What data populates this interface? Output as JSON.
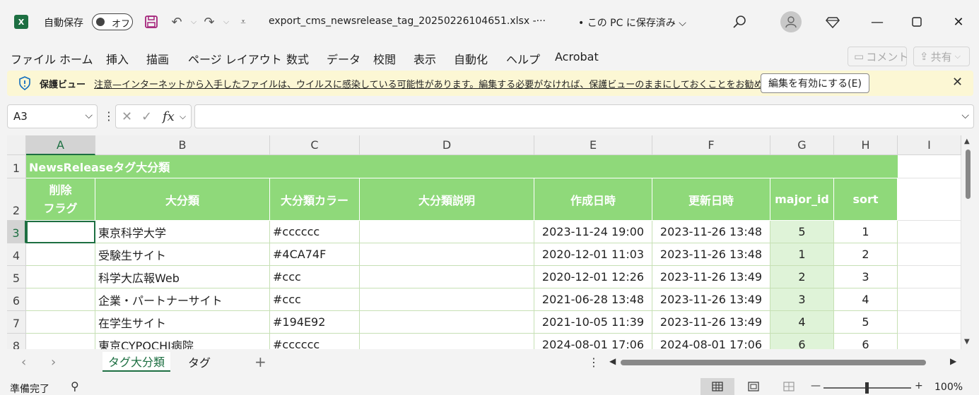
{
  "titlebar": {
    "app_logo": "X",
    "autosave_label": "自動保存",
    "autosave_state": "オフ",
    "filename": "export_cms_newsrelease_tag_20250226104651.xlsx  -···",
    "save_state": "• この PC に保存済み ⌵",
    "icons": [
      "save-icon",
      "undo-icon",
      "redo-icon",
      "customize-icon",
      "search-icon",
      "avatar",
      "diamond-icon",
      "minimize-icon",
      "maximize-icon",
      "close-icon"
    ]
  },
  "menu": {
    "items": [
      "ファイル",
      "ホーム",
      "挿入",
      "描画",
      "ページ レイアウト",
      "数式",
      "データ",
      "校閲",
      "表示",
      "自動化",
      "ヘルプ",
      "Acrobat"
    ],
    "comment_label": "コメント",
    "share_label": "共有"
  },
  "protected_view": {
    "title": "保護ビュー",
    "message": "注意—インターネットから入手したファイルは、ウイルスに感染している可能性があります。編集する必要がなければ、保護ビューのままにしておくことをお勧めします。",
    "enable_button": "編集を有効にする(E)"
  },
  "formula_bar": {
    "name_box": "A3",
    "fx_label": "fx",
    "formula": ""
  },
  "grid": {
    "columns": [
      "A",
      "B",
      "C",
      "D",
      "E",
      "F",
      "G",
      "H",
      "I"
    ],
    "rows": [
      "1",
      "2",
      "3",
      "4",
      "5",
      "6",
      "7",
      "8"
    ],
    "sheet_title": "NewsReleaseタグ大分類",
    "header_a_line1": "削除",
    "header_a_line2": "フラグ",
    "headers": [
      "大分類",
      "大分類カラー",
      "大分類説明",
      "作成日時",
      "更新日時",
      "major_id",
      "sort"
    ],
    "data": [
      {
        "del": "",
        "name": "東京科学大学",
        "color": "#cccccc",
        "desc": "",
        "created": "2023-11-24 19:00",
        "updated": "2023-11-26 13:48",
        "major_id": "5",
        "sort": "1"
      },
      {
        "del": "",
        "name": "受験生サイト",
        "color": "#4CA74F",
        "desc": "",
        "created": "2020-12-01 11:03",
        "updated": "2023-11-26 13:48",
        "major_id": "1",
        "sort": "2"
      },
      {
        "del": "",
        "name": "科学大広報Web",
        "color": "#ccc",
        "desc": "",
        "created": "2020-12-01 12:26",
        "updated": "2023-11-26 13:49",
        "major_id": "2",
        "sort": "3"
      },
      {
        "del": "",
        "name": "企業・パートナーサイト",
        "color": "#ccc",
        "desc": "",
        "created": "2021-06-28 13:48",
        "updated": "2023-11-26 13:49",
        "major_id": "3",
        "sort": "4"
      },
      {
        "del": "",
        "name": "在学生サイト",
        "color": "#194E92",
        "desc": "",
        "created": "2021-10-05 11:39",
        "updated": "2023-11-26 13:49",
        "major_id": "4",
        "sort": "5"
      },
      {
        "del": "",
        "name": "東京CYPOCHI病院",
        "color": "#cccccc",
        "desc": "",
        "created": "2024-08-01 17:06",
        "updated": "2024-08-01 17:06",
        "major_id": "6",
        "sort": "6"
      }
    ]
  },
  "sheets": {
    "tabs": [
      "タグ大分類",
      "タグ"
    ],
    "active": 0,
    "add": "+"
  },
  "status": {
    "ready": "準備完了",
    "zoom": "100%"
  },
  "colors": {
    "header_green": "#8fd97a",
    "major_id_fill": "#dff3d8",
    "excel_green": "#1d6f42",
    "protected_bar": "#fcf7d4"
  }
}
